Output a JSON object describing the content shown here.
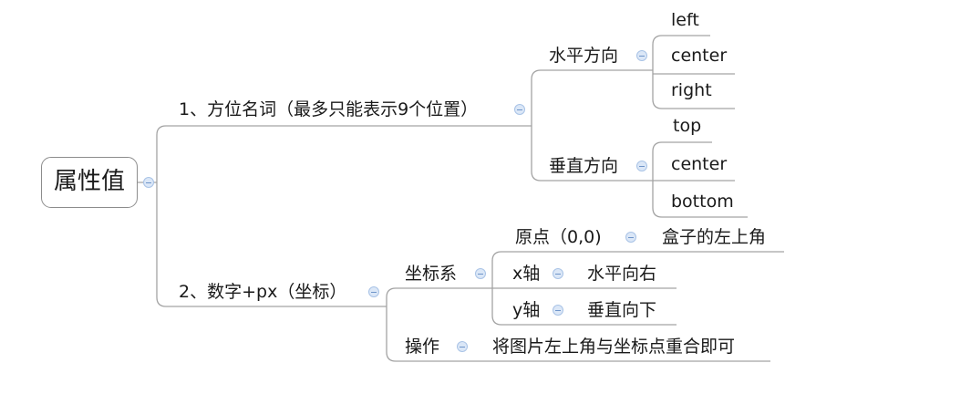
{
  "root": {
    "label": "属性值"
  },
  "branches": {
    "b1": {
      "label": "1、方位名词（最多只能表示9个位置）",
      "horizontal": {
        "label": "水平方向",
        "items": [
          "left",
          "center",
          "right"
        ]
      },
      "vertical": {
        "label": "垂直方向",
        "items": [
          "top",
          "center",
          "bottom"
        ]
      }
    },
    "b2": {
      "label": "2、数字+px（坐标）",
      "coord": {
        "label": "坐标系",
        "origin": {
          "label": "原点（0,0)",
          "value": "盒子的左上角"
        },
        "xaxis": {
          "label": "x轴",
          "value": "水平向右"
        },
        "yaxis": {
          "label": "y轴",
          "value": "垂直向下"
        }
      },
      "operation": {
        "label": "操作",
        "value": "将图片左上角与坐标点重合即可"
      }
    }
  },
  "colors": {
    "line": "#a3a3a3",
    "toggle_fill": "#dbe7f7",
    "toggle_border": "#a9c3e6"
  }
}
